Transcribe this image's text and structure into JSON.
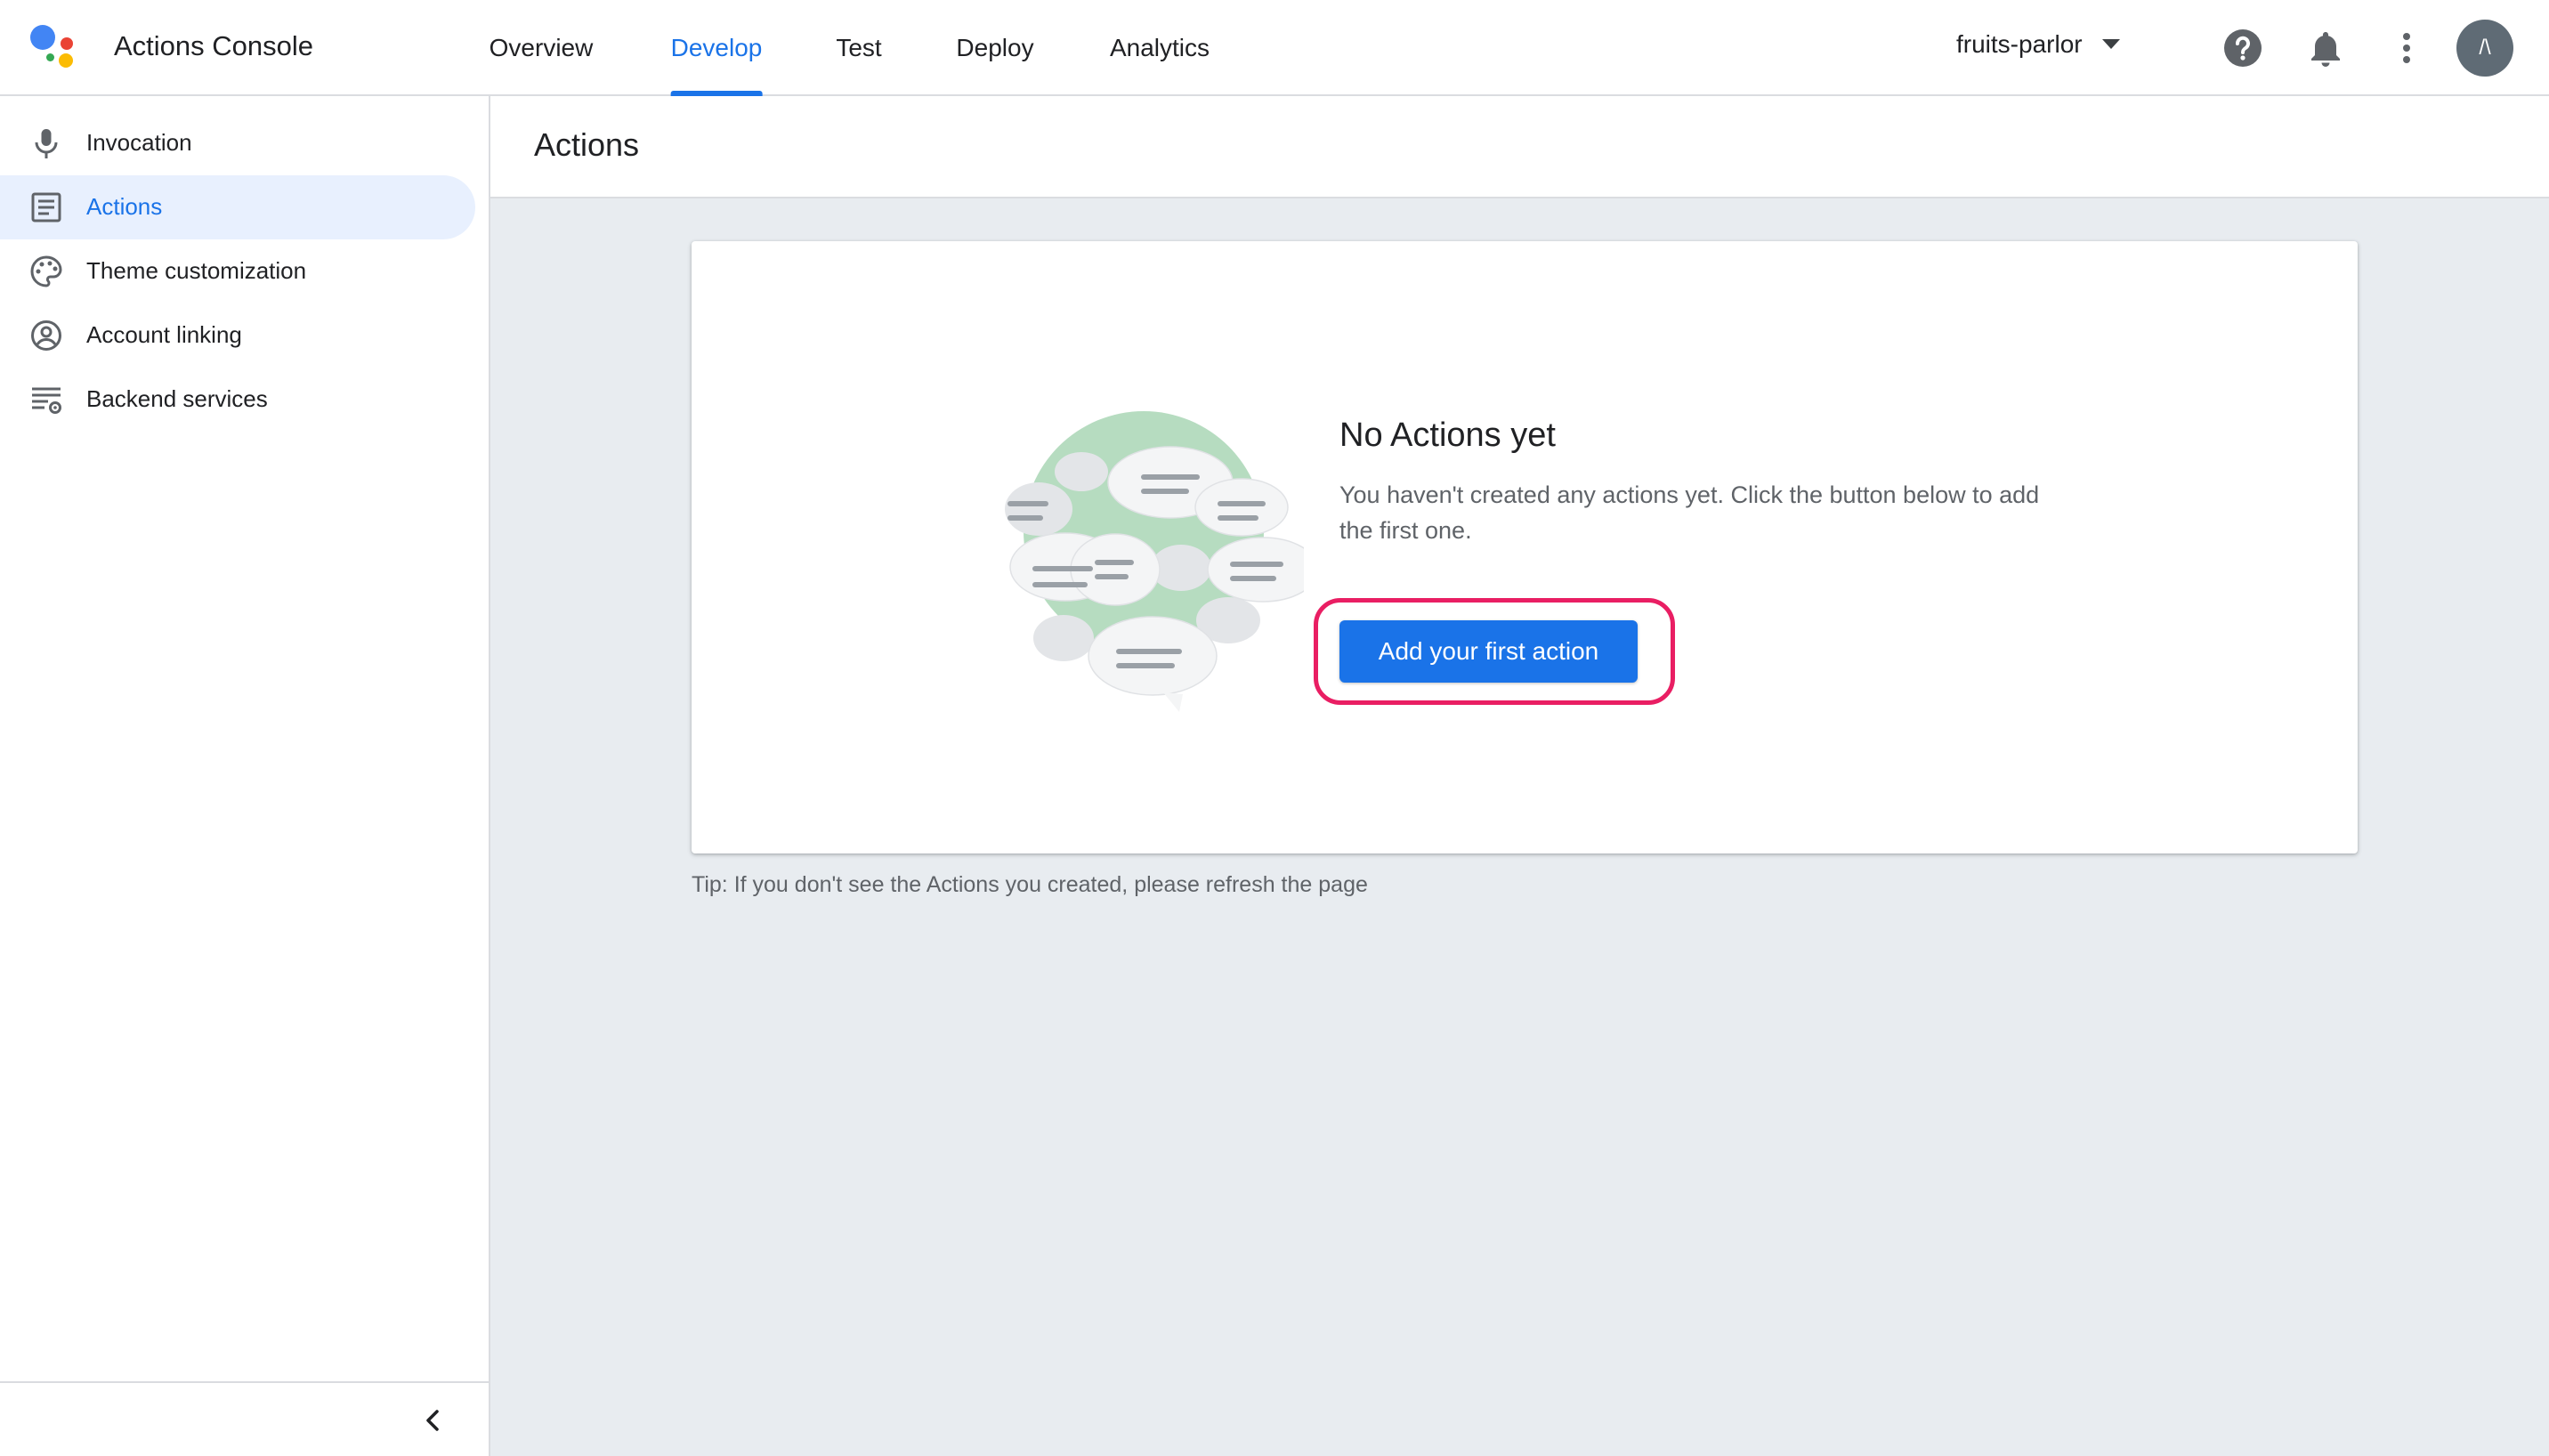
{
  "app": {
    "title": "Actions Console"
  },
  "tabs": [
    {
      "label": "Overview",
      "active": false
    },
    {
      "label": "Develop",
      "active": true
    },
    {
      "label": "Test",
      "active": false
    },
    {
      "label": "Deploy",
      "active": false
    },
    {
      "label": "Analytics",
      "active": false
    }
  ],
  "project": {
    "name": "fruits-parlor"
  },
  "header_icons": [
    "help-icon",
    "notifications-icon",
    "more-vert-icon"
  ],
  "avatar": {
    "initials": "/\\"
  },
  "sidebar": {
    "items": [
      {
        "label": "Invocation",
        "icon": "microphone-icon",
        "active": false
      },
      {
        "label": "Actions",
        "icon": "list-icon",
        "active": true
      },
      {
        "label": "Theme customization",
        "icon": "palette-icon",
        "active": false
      },
      {
        "label": "Account linking",
        "icon": "account-circle-icon",
        "active": false
      },
      {
        "label": "Backend services",
        "icon": "settings-list-icon",
        "active": false
      }
    ],
    "collapse_icon": "chevron-left-icon"
  },
  "main": {
    "title": "Actions",
    "empty_state": {
      "title": "No Actions yet",
      "description": "You haven't created any actions yet. Click the button below to add the first one.",
      "button_label": "Add your first action"
    },
    "tip": "Tip: If you don't see the Actions you created, please refresh the page"
  },
  "colors": {
    "accent": "#1a73e8",
    "active_nav_bg": "#e8f0fe",
    "highlight_ring": "#e91e63",
    "content_bg": "#e8ecf0"
  }
}
